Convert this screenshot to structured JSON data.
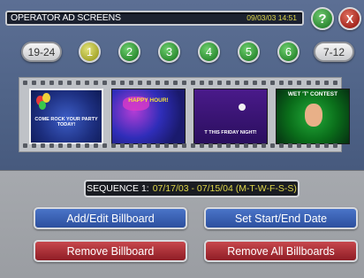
{
  "header": {
    "title": "OPERATOR AD SCREENS",
    "datetime": "09/03/03  14:51",
    "help_label": "?",
    "close_label": "X"
  },
  "pager": {
    "prev_label": "19-24",
    "next_label": "7-12",
    "pages": [
      "1",
      "2",
      "3",
      "4",
      "5",
      "6"
    ],
    "active_page": "1"
  },
  "thumbnails": [
    {
      "caption": "COME ROCK YOUR PARTY TODAY!",
      "selected": true
    },
    {
      "caption": "HAPPY HOUR!",
      "selected": false
    },
    {
      "caption": "T THIS FRIDAY NIGHT!",
      "selected": false
    },
    {
      "caption": "WET 'T' CONTEST",
      "selected": false
    }
  ],
  "sequence": {
    "label": "SEQUENCE 1:",
    "range": "07/17/03 - 07/15/04 (M-T-W-F-S-S)"
  },
  "actions": {
    "add_edit": "Add/Edit Billboard",
    "set_dates": "Set Start/End Date",
    "remove": "Remove Billboard",
    "remove_all": "Remove All Billboards"
  },
  "colors": {
    "accent_yellow": "#e0d84a",
    "page_green": "#2b8a30",
    "page_active": "#a5a62b",
    "blue_button": "#2c4f9e",
    "red_button": "#8f1d25"
  }
}
